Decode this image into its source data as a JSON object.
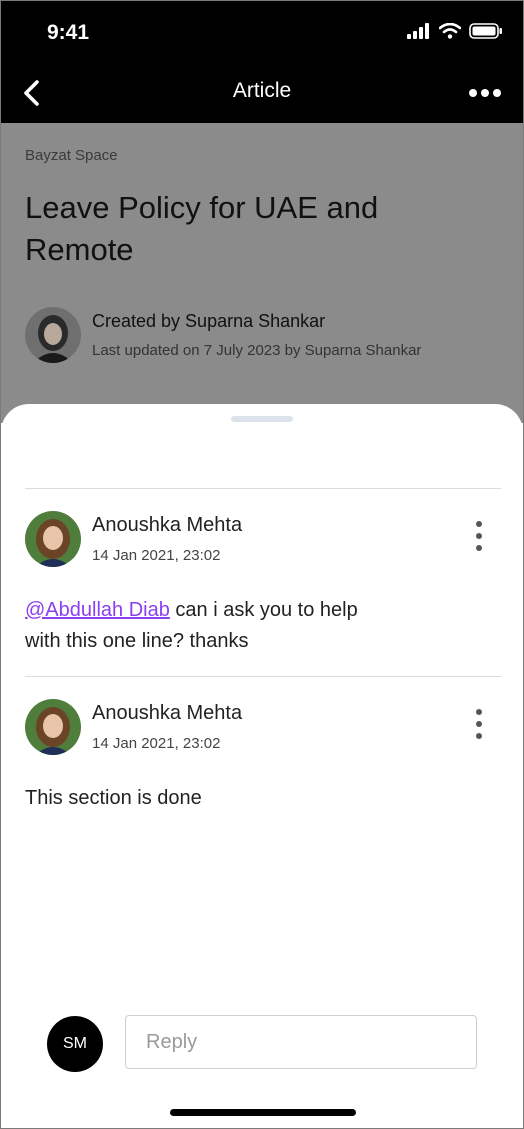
{
  "status_bar": {
    "time": "9:41"
  },
  "nav": {
    "title": "Article",
    "back_icon": "chevron-left-icon",
    "more_icon": "more-horizontal-icon"
  },
  "article": {
    "space": "Bayzat Space",
    "title": "Leave Policy for UAE and Remote",
    "created_by": "Created by Suparna Shankar",
    "last_updated": "Last updated on 7 July 2023 by Suparna Shankar"
  },
  "comments": [
    {
      "author": "Anoushka Mehta",
      "timestamp": "14 Jan 2021, 23:02",
      "mention": "@Abdullah Diab",
      "text": " can i ask you to help with this one line? thanks"
    },
    {
      "author": "Anoushka Mehta",
      "timestamp": "14 Jan 2021, 23:02",
      "mention": "",
      "text": "This section is done"
    }
  ],
  "reply": {
    "avatar_initials": "SM",
    "placeholder": "Reply"
  },
  "colors": {
    "mention": "#8a3ff2",
    "header": "#000000",
    "overlay": "#8b8b8b"
  }
}
